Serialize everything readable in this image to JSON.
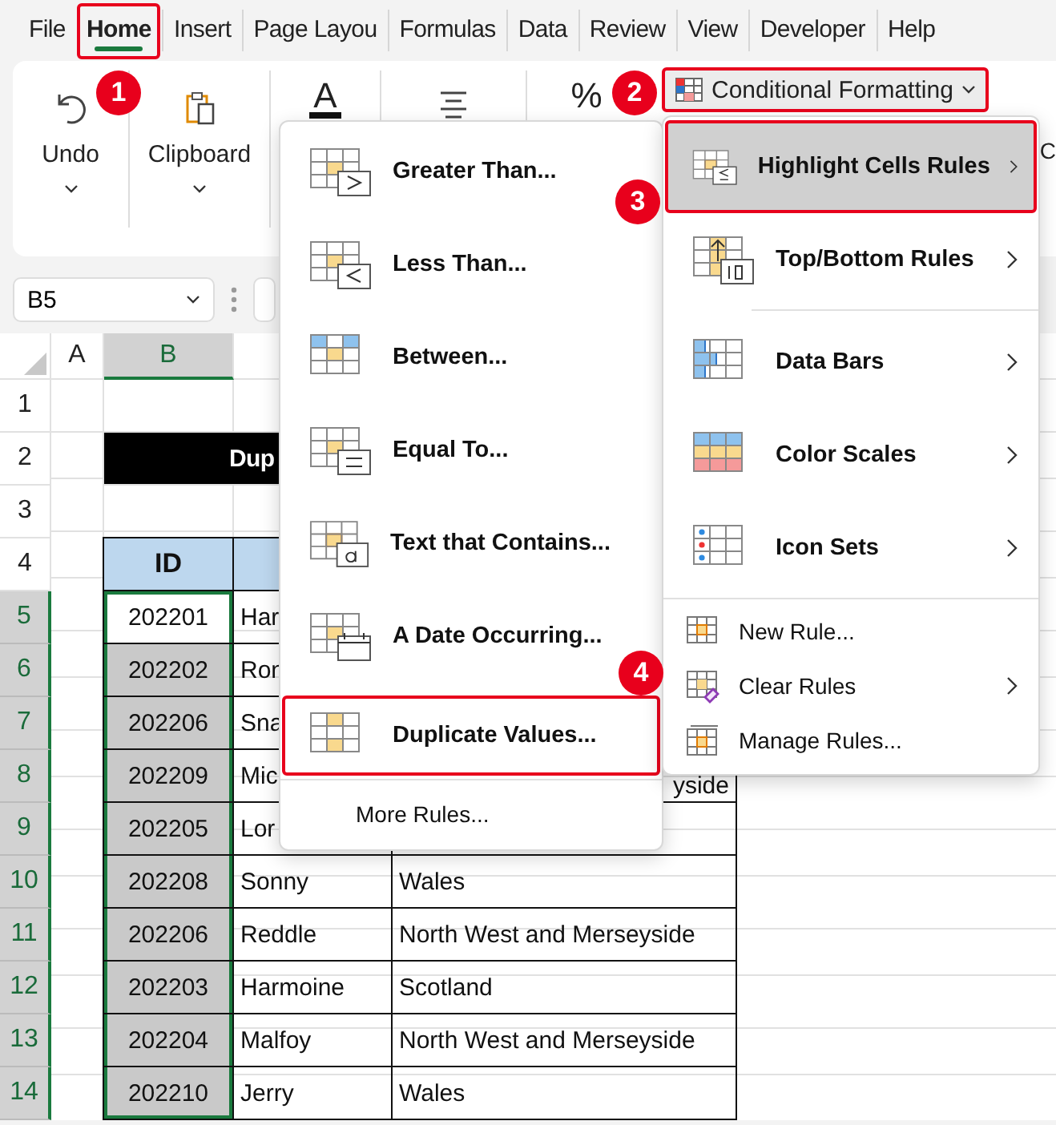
{
  "tabs": [
    {
      "label": "File",
      "selected": false,
      "outlined": false
    },
    {
      "label": "Home",
      "selected": true,
      "outlined": true
    },
    {
      "label": "Insert",
      "selected": false,
      "outlined": false
    },
    {
      "label": "Page Layou",
      "selected": false,
      "outlined": false
    },
    {
      "label": "Formulas",
      "selected": false,
      "outlined": false
    },
    {
      "label": "Data",
      "selected": false,
      "outlined": false
    },
    {
      "label": "Review",
      "selected": false,
      "outlined": false
    },
    {
      "label": "View",
      "selected": false,
      "outlined": false
    },
    {
      "label": "Developer",
      "selected": false,
      "outlined": false
    },
    {
      "label": "Help",
      "selected": false,
      "outlined": false
    }
  ],
  "ribbon": {
    "undo_label": "Undo",
    "clipboard_label": "Clipboard",
    "font_glyph": "A",
    "number_glyph": "%",
    "conditional_formatting": {
      "label": "Conditional Formatting",
      "outlined": true
    },
    "cut_label": "C"
  },
  "name_box": {
    "value": "B5"
  },
  "columns": [
    {
      "label": "A",
      "selected": false
    },
    {
      "label": "B",
      "selected": true
    }
  ],
  "rows": [
    {
      "label": "1",
      "selected": false
    },
    {
      "label": "2",
      "selected": false
    },
    {
      "label": "3",
      "selected": false
    },
    {
      "label": "4",
      "selected": false
    },
    {
      "label": "5",
      "selected": true
    },
    {
      "label": "6",
      "selected": true
    },
    {
      "label": "7",
      "selected": true
    },
    {
      "label": "8",
      "selected": true
    },
    {
      "label": "9",
      "selected": true
    },
    {
      "label": "10",
      "selected": true
    },
    {
      "label": "11",
      "selected": true
    },
    {
      "label": "12",
      "selected": true
    },
    {
      "label": "13",
      "selected": true
    },
    {
      "label": "14",
      "selected": true
    }
  ],
  "title_cell": "Dup",
  "table": {
    "header": "ID",
    "rows": [
      {
        "id": "202201",
        "name": "Har",
        "active": true
      },
      {
        "id": "202202",
        "name": "Ron",
        "active": false
      },
      {
        "id": "202206",
        "name": "Sna",
        "active": false
      },
      {
        "id": "202209",
        "name": "Mic",
        "region": "yside",
        "active": false
      },
      {
        "id": "202205",
        "name": "Lor",
        "active": false
      },
      {
        "id": "202208",
        "name": "Sonny",
        "region": "Wales",
        "active": false
      },
      {
        "id": "202206",
        "name": "Reddle",
        "region": "North West and Merseyside",
        "active": false
      },
      {
        "id": "202203",
        "name": "Harmoine",
        "region": "Scotland",
        "active": false
      },
      {
        "id": "202204",
        "name": "Malfoy",
        "region": "North West and Merseyside",
        "active": false
      },
      {
        "id": "202210",
        "name": "Jerry",
        "region": "Wales",
        "active": false
      }
    ]
  },
  "submenu": {
    "items": [
      {
        "kind": "large",
        "label": "Greater Than...",
        "selected": false,
        "outlined": false
      },
      {
        "kind": "large",
        "label": "Less Than...",
        "selected": false,
        "outlined": false
      },
      {
        "kind": "large",
        "label": "Between...",
        "selected": false,
        "outlined": false
      },
      {
        "kind": "large",
        "label": "Equal To...",
        "selected": false,
        "outlined": false
      },
      {
        "kind": "large",
        "label": "Text that Contains...",
        "selected": false,
        "outlined": false
      },
      {
        "kind": "large",
        "label": "A Date Occurring...",
        "selected": false,
        "outlined": false
      },
      {
        "kind": "large",
        "label": "Duplicate Values...",
        "selected": false,
        "outlined": true
      },
      {
        "kind": "divider"
      },
      {
        "kind": "plain",
        "label": "More Rules...",
        "selected": false,
        "outlined": false
      }
    ]
  },
  "cf_menu": {
    "items": [
      {
        "kind": "large",
        "label": "Highlight Cells Rules",
        "has_submenu": true,
        "selected": true,
        "outlined": true
      },
      {
        "kind": "large",
        "label": "Top/Bottom Rules",
        "has_submenu": true,
        "selected": false,
        "outlined": false
      },
      {
        "kind": "divider"
      },
      {
        "kind": "large",
        "label": "Data Bars",
        "has_submenu": true,
        "selected": false,
        "outlined": false
      },
      {
        "kind": "large",
        "label": "Color Scales",
        "has_submenu": true,
        "selected": false,
        "outlined": false
      },
      {
        "kind": "large",
        "label": "Icon Sets",
        "has_submenu": true,
        "selected": false,
        "outlined": false
      },
      {
        "kind": "divider"
      },
      {
        "kind": "small",
        "label": "New Rule...",
        "has_submenu": false,
        "selected": false,
        "outlined": false
      },
      {
        "kind": "small",
        "label": "Clear Rules",
        "has_submenu": true,
        "selected": false,
        "outlined": false
      },
      {
        "kind": "small",
        "label": "Manage Rules...",
        "has_submenu": false,
        "selected": false,
        "outlined": false
      }
    ]
  },
  "badges": [
    "1",
    "2",
    "3",
    "4"
  ]
}
